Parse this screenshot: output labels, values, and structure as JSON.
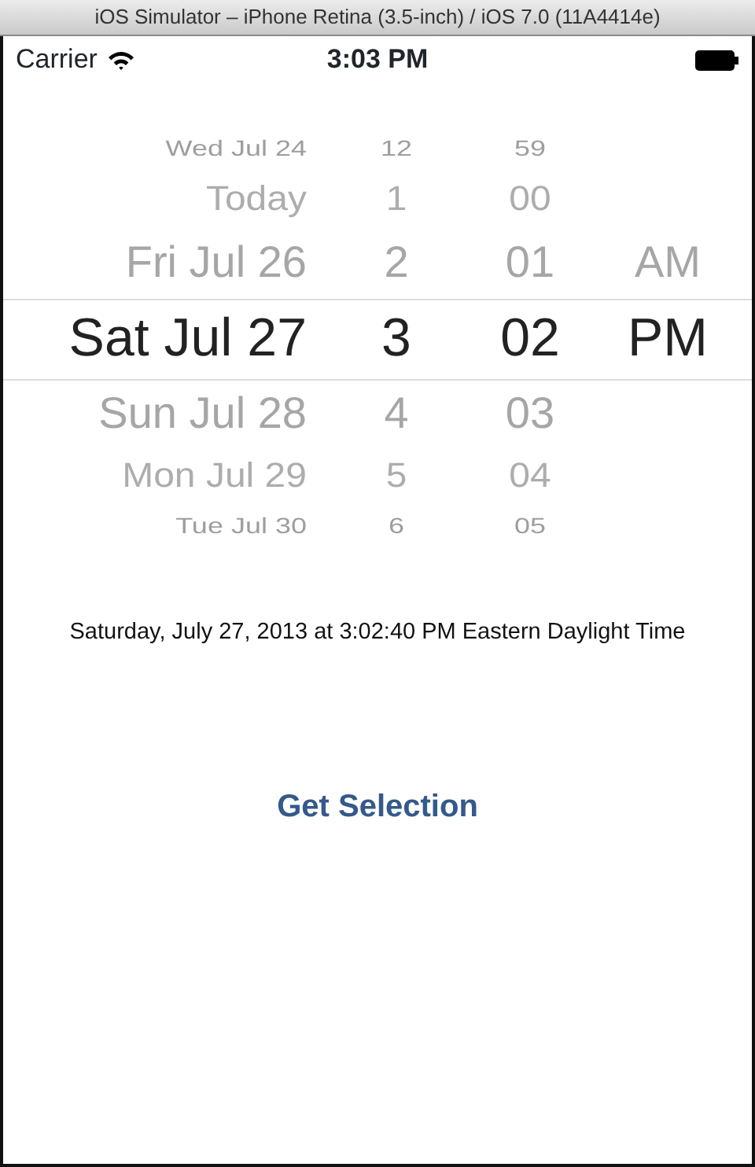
{
  "window": {
    "title": "iOS Simulator – iPhone Retina (3.5-inch) / iOS 7.0 (11A4414e)"
  },
  "status_bar": {
    "carrier": "Carrier",
    "time": "3:03 PM"
  },
  "picker": {
    "rows": [
      {
        "date": "Wed Jul 24",
        "hour": "12",
        "minute": "59",
        "selected": false
      },
      {
        "date": "Today",
        "hour": "1",
        "minute": "00",
        "selected": false
      },
      {
        "date": "Fri Jul 26",
        "hour": "2",
        "minute": "01",
        "period": "AM",
        "selected": false
      },
      {
        "date": "Sat Jul 27",
        "hour": "3",
        "minute": "02",
        "period": "PM",
        "selected": true
      },
      {
        "date": "Sun Jul 28",
        "hour": "4",
        "minute": "03",
        "selected": false
      },
      {
        "date": "Mon Jul 29",
        "hour": "5",
        "minute": "04",
        "selected": false
      },
      {
        "date": "Tue Jul 30",
        "hour": "6",
        "minute": "05",
        "selected": false
      }
    ]
  },
  "selection_text": "Saturday, July 27, 2013 at 3:02:40 PM Eastern Daylight Time",
  "button": "Get Selection"
}
